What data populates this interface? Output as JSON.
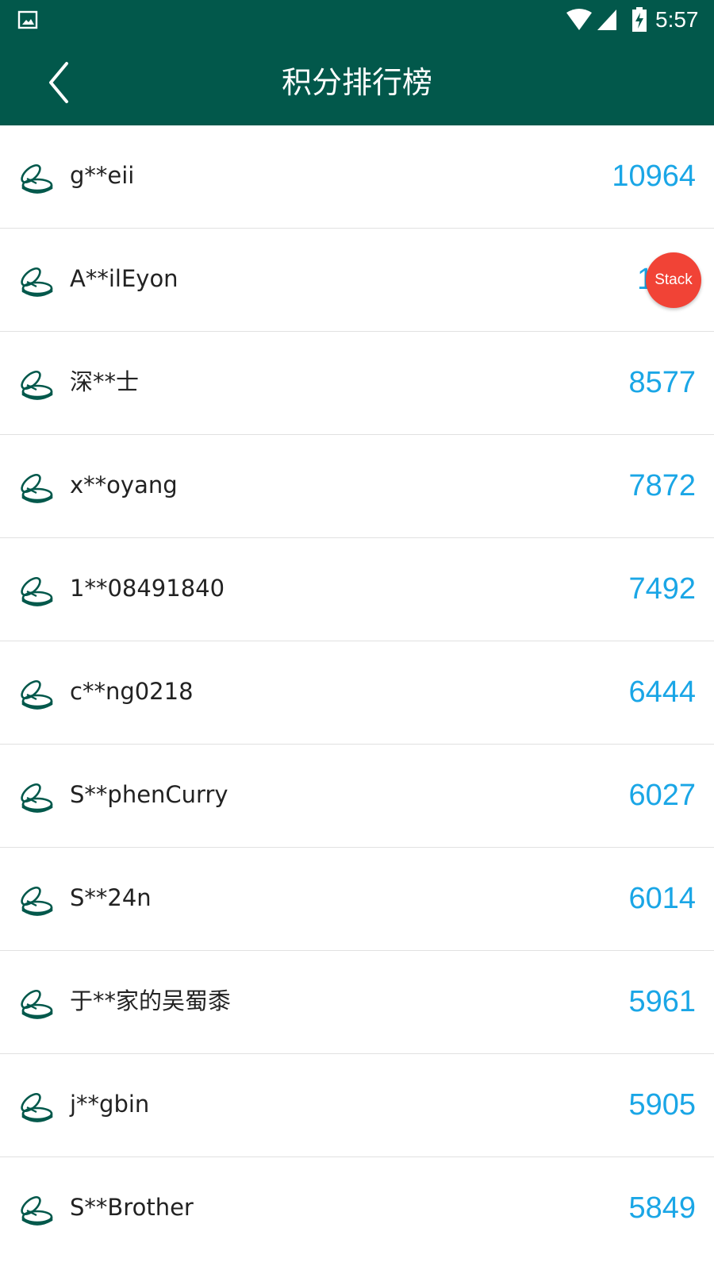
{
  "status_bar": {
    "time": "5:57",
    "icons": [
      "gallery-icon",
      "wifi-icon",
      "signal-icon",
      "battery-charging-icon"
    ]
  },
  "app_bar": {
    "title": "积分排行榜",
    "back_icon": "chevron-left-icon"
  },
  "colors": {
    "header": "#02584b",
    "score": "#1aa6e6",
    "badge": "#f14336",
    "icon": "#02584b"
  },
  "row_icon": "coins-icon",
  "floating_badge": {
    "label": "Stack"
  },
  "rankings": [
    {
      "name": "g**eii",
      "score": "10964"
    },
    {
      "name": "A**ilEyon",
      "score": "1   5"
    },
    {
      "name": "深**士",
      "score": "8577"
    },
    {
      "name": "x**oyang",
      "score": "7872"
    },
    {
      "name": "1**08491840",
      "score": "7492"
    },
    {
      "name": "c**ng0218",
      "score": "6444"
    },
    {
      "name": "S**phenCurry",
      "score": "6027"
    },
    {
      "name": "S**24n",
      "score": "6014"
    },
    {
      "name": "于**家的吴蜀黍",
      "score": "5961"
    },
    {
      "name": "j**gbin",
      "score": "5905"
    },
    {
      "name": "S**Brother",
      "score": "5849"
    }
  ]
}
